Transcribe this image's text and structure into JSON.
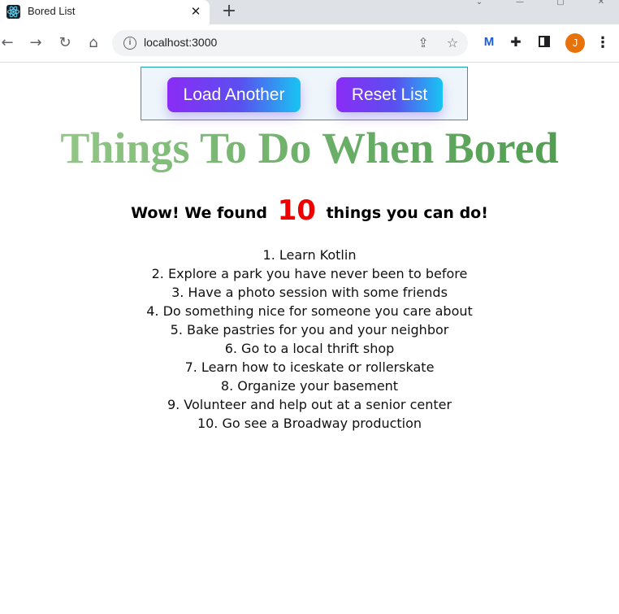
{
  "browser": {
    "tab_title": "Bored List",
    "tab_close_glyph": "✕",
    "new_tab_glyph": "+",
    "url": "localhost:3000",
    "avatar_letter": "J",
    "extension_letter": "M",
    "icons": [
      "back-icon",
      "forward-icon",
      "reload-icon",
      "home-icon",
      "info-icon",
      "share-icon",
      "star-icon",
      "puzzle-icon",
      "side-panel-icon",
      "menu-icon"
    ]
  },
  "buttons": {
    "load_label": "Load Another",
    "reset_label": "Reset List"
  },
  "heading": {
    "title": "Things To Do When Bored",
    "found_prefix": "Wow! We found",
    "found_count": "10",
    "found_suffix": "things you can do!"
  },
  "activities": [
    "1. Learn Kotlin",
    "2. Explore a park you have never been to before",
    "3. Have a photo session with some friends",
    "4. Do something nice for someone you care about",
    "5. Bake pastries for you and your neighbor",
    "6. Go to a local thrift shop",
    "7. Learn how to iceskate or rollerskate",
    "8. Organize your basement",
    "9. Volunteer and help out at a senior center",
    "10. Go see a Broadway production"
  ],
  "colors": {
    "button_gradient_start": "#8a2cf5",
    "button_gradient_end": "#18c5f2",
    "panel_border": "#17a2b8",
    "title_green_light": "#9ccc8e",
    "title_green_dark": "#4a9a4c",
    "count_red": "#ee0000"
  }
}
